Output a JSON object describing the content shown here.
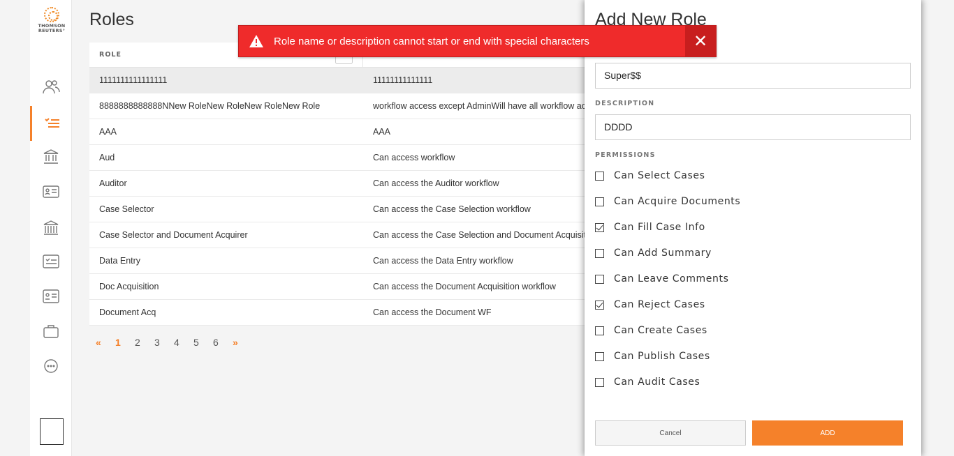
{
  "brand": {
    "logo_line1": "THOMSON",
    "logo_line2": "REUTERS°"
  },
  "nav": [
    {
      "icon": "users-icon",
      "active": false
    },
    {
      "icon": "checklist-icon",
      "active": true
    },
    {
      "icon": "institution-icon",
      "active": false
    },
    {
      "icon": "id-card-icon",
      "active": false
    },
    {
      "icon": "bank-icon",
      "active": false
    },
    {
      "icon": "task-list-icon",
      "active": false
    },
    {
      "icon": "profile-card-icon",
      "active": false
    },
    {
      "icon": "briefcase-icon",
      "active": false
    },
    {
      "icon": "more-icon",
      "active": false
    }
  ],
  "page": {
    "title": "Roles"
  },
  "table": {
    "col_role": "ROLE",
    "rows": [
      {
        "role": "1111111111111111",
        "description": "11111111111111"
      },
      {
        "role": "8888888888888NNew RoleNew RoleNew RoleNew Role",
        "description": "workflow access except AdminWill have all workflow access"
      },
      {
        "role": "AAA",
        "description": "AAA"
      },
      {
        "role": "Aud",
        "description": "Can access workflow"
      },
      {
        "role": "Auditor",
        "description": "Can access the Auditor workflow"
      },
      {
        "role": "Case Selector",
        "description": "Can access the Case Selection workflow"
      },
      {
        "role": "Case Selector and Document Acquirer",
        "description": "Can access the Case Selection and Document Acquisition workflow"
      },
      {
        "role": "Data Entry",
        "description": "Can access the Data Entry workflow"
      },
      {
        "role": "Doc Acquisition",
        "description": "Can access the Document Acquisition workflow"
      },
      {
        "role": "Document Acq",
        "description": "Can access the Document WF"
      }
    ]
  },
  "pager": {
    "prev": "«",
    "pages": [
      "1",
      "2",
      "3",
      "4",
      "5",
      "6"
    ],
    "current": "1",
    "next": "»"
  },
  "panel": {
    "title": "Add New Role",
    "name_value": "Super$$",
    "description_label": "DESCRIPTION",
    "description_value": "DDDD",
    "permissions_label": "PERMISSIONS",
    "permissions": [
      {
        "label": "Can Select Cases",
        "checked": false
      },
      {
        "label": "Can Acquire Documents",
        "checked": false
      },
      {
        "label": "Can Fill Case Info",
        "checked": true
      },
      {
        "label": "Can Add Summary",
        "checked": false
      },
      {
        "label": "Can Leave Comments",
        "checked": false
      },
      {
        "label": "Can Reject Cases",
        "checked": true
      },
      {
        "label": "Can Create Cases",
        "checked": false
      },
      {
        "label": "Can Publish Cases",
        "checked": false
      },
      {
        "label": "Can Audit Cases",
        "checked": false
      }
    ],
    "cancel_label": "Cancel",
    "add_label": "ADD"
  },
  "toast": {
    "message": "Role name or description cannot start or end with special characters",
    "close_glyph": "✕",
    "icon": "warning-icon"
  },
  "colors": {
    "accent": "#f5812a",
    "error": "#ef2b2b"
  }
}
